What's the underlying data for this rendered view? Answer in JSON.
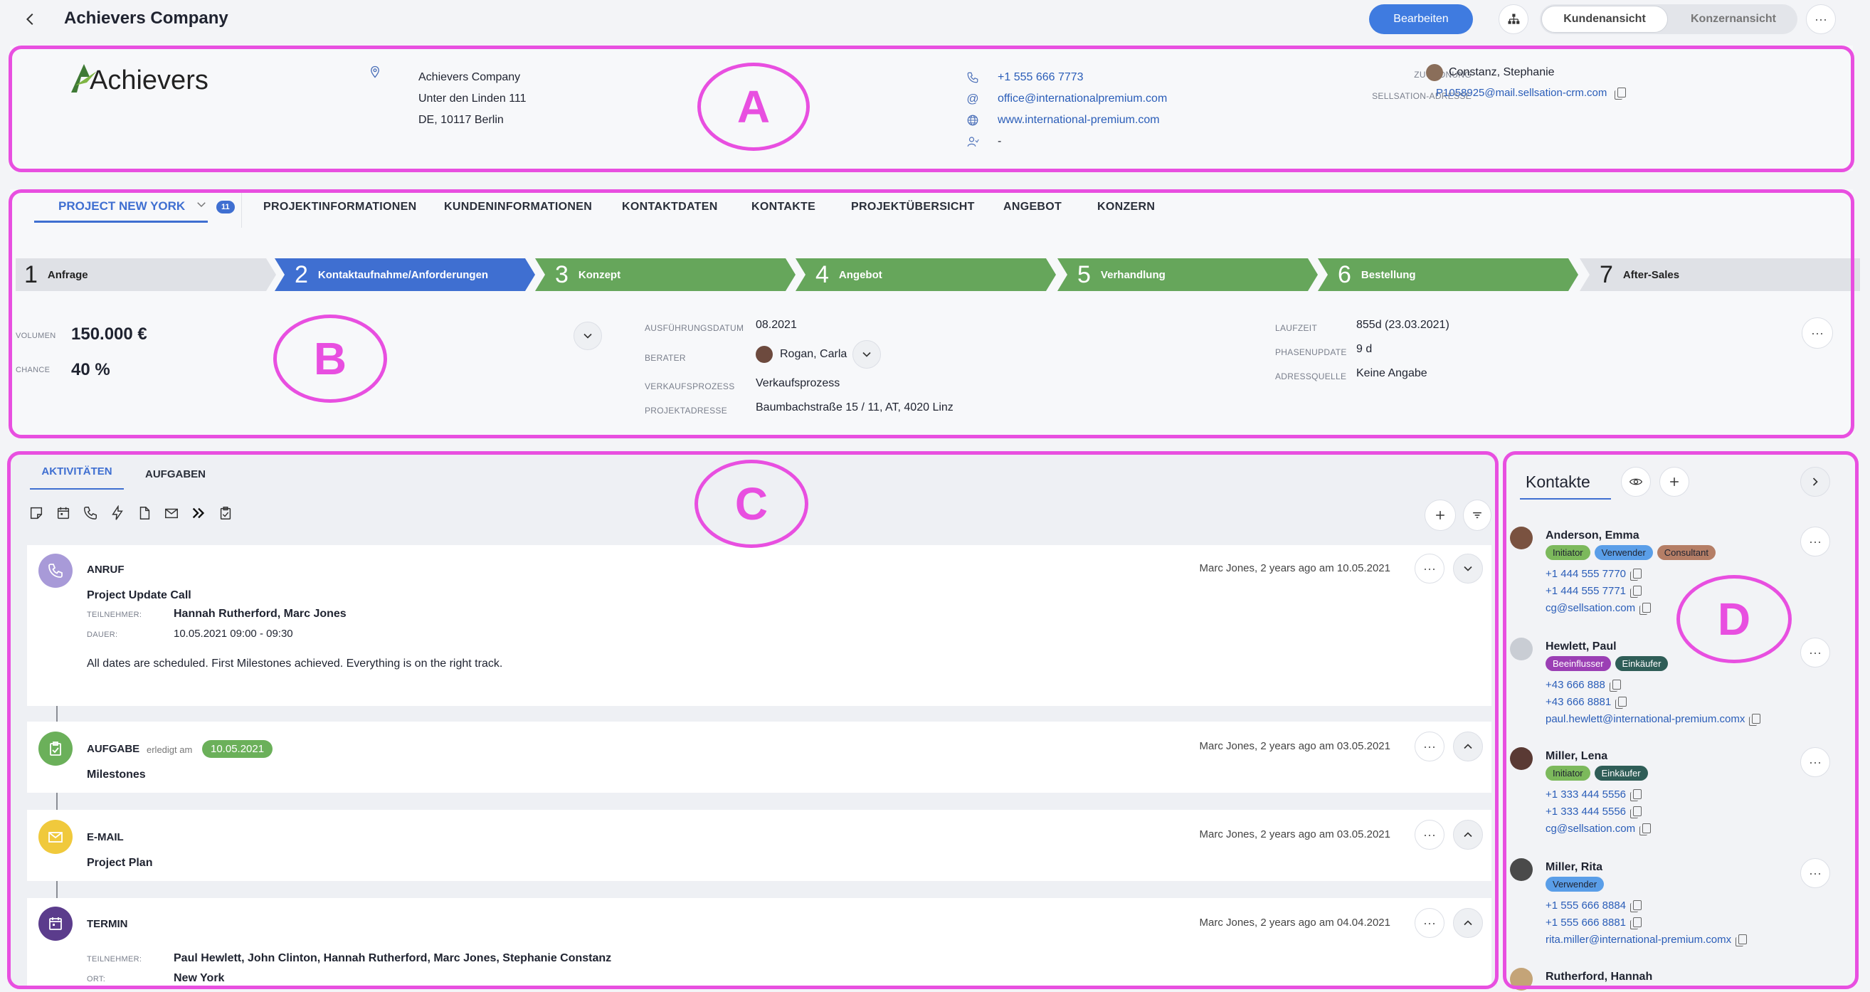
{
  "header": {
    "title": "Achievers Company",
    "edit_label": "Bearbeiten",
    "view_customer": "Kundenansicht",
    "view_group": "Konzernansicht"
  },
  "company": {
    "logo_text": "Achievers",
    "name": "Achievers Company",
    "street": "Unter den Linden 111",
    "city": "DE, 10117 Berlin",
    "phone": "+1 555 666 7773",
    "email": "office@internationalpremium.com",
    "website": "www.international-premium.com",
    "contact_person": "-",
    "assignment_label": "ZUORDNUNG",
    "assignment_value": "Constanz, Stephanie",
    "sellsation_label": "SELLSATION-ADRESSE",
    "sellsation_value": "P1058925@mail.sellsation-crm.com"
  },
  "project": {
    "name": "PROJECT NEW YORK",
    "count_badge": "11",
    "tabs": [
      "PROJEKTINFORMATIONEN",
      "KUNDENINFORMATIONEN",
      "KONTAKTDATEN",
      "KONTAKTE",
      "PROJEKTÜBERSICHT",
      "ANGEBOT",
      "KONZERN"
    ],
    "steps": [
      {
        "num": "1",
        "label": "Anfrage"
      },
      {
        "num": "2",
        "label": "Kontaktaufnahme/Anforderungen"
      },
      {
        "num": "3",
        "label": "Konzept"
      },
      {
        "num": "4",
        "label": "Angebot"
      },
      {
        "num": "5",
        "label": "Verhandlung"
      },
      {
        "num": "6",
        "label": "Bestellung"
      },
      {
        "num": "7",
        "label": "After-Sales"
      }
    ],
    "volume_label": "VOLUMEN",
    "volume_value": "150.000 €",
    "chance_label": "CHANCE",
    "chance_value": "40 %",
    "exec_date_label": "AUSFÜHRUNGSDATUM",
    "exec_date_value": "08.2021",
    "advisor_label": "BERATER",
    "advisor_value": "Rogan, Carla",
    "sales_process_label": "VERKAUFSPROZESS",
    "sales_process_value": "Verkaufsprozess",
    "project_address_label": "PROJEKTADRESSE",
    "project_address_value": "Baumbachstraße 15 / 11, AT, 4020 Linz",
    "runtime_label": "LAUFZEIT",
    "runtime_value": "855d (23.03.2021)",
    "phase_update_label": "PHASENUPDATE",
    "phase_update_value": "9 d",
    "address_source_label": "ADRESSQUELLE",
    "address_source_value": "Keine Angabe"
  },
  "activities": {
    "tab_activities": "AKTIVITÄTEN",
    "tab_tasks": "AUFGABEN",
    "items": [
      {
        "type": "ANRUF",
        "meta": "Marc Jones, 2 years ago am 10.05.2021",
        "title": "Project Update Call",
        "participants_label": "TEILNEHMER:",
        "participants": "Hannah Rutherford, Marc Jones",
        "duration_label": "DAUER:",
        "duration": "10.05.2021 09:00 - 09:30",
        "body": "All dates are scheduled. First Milestones achieved. Everything is on the right track."
      },
      {
        "type": "AUFGABE",
        "done_label": "erledigt am",
        "done_date": "10.05.2021",
        "meta": "Marc Jones, 2 years ago am 03.05.2021",
        "title": "Milestones"
      },
      {
        "type": "E-MAIL",
        "meta": "Marc Jones, 2 years ago am 03.05.2021",
        "title": "Project Plan"
      },
      {
        "type": "TERMIN",
        "meta": "Marc Jones, 2 years ago am 04.04.2021",
        "participants_label": "TEILNEHMER:",
        "participants": "Paul Hewlett, John Clinton, Hannah Rutherford, Marc Jones, Stephanie Constanz",
        "location_label": "ORT:",
        "location": "New York"
      }
    ]
  },
  "contacts": {
    "title": "Kontakte",
    "items": [
      {
        "name": "Anderson, Emma",
        "tags": [
          "Initiator",
          "Verwender",
          "Consultant"
        ],
        "phone1": "+1 444 555 7770",
        "phone2": "+1 444 555 7771",
        "email": "cg@sellsation.com"
      },
      {
        "name": "Hewlett, Paul",
        "tags": [
          "Beeinflusser",
          "Einkäufer"
        ],
        "phone1": "+43 666 888",
        "phone2": "+43 666 8881",
        "email": "paul.hewlett@international-premium.comx"
      },
      {
        "name": "Miller, Lena",
        "tags": [
          "Initiator",
          "Einkäufer"
        ],
        "phone1": "+1 333 444 5556",
        "phone2": "+1 333 444 5556",
        "email": "cg@sellsation.com"
      },
      {
        "name": "Miller, Rita",
        "tags": [
          "Verwender"
        ],
        "phone1": "+1 555 666 8884",
        "phone2": "+1 555 666 8881",
        "email": "rita.miller@international-premium.comx"
      },
      {
        "name": "Rutherford, Hannah"
      }
    ]
  },
  "annotations": [
    "A",
    "B",
    "C",
    "D"
  ],
  "colors": {
    "primary": "#3f6fd1",
    "step_green": "#66a65b",
    "step_grey": "#dfe1e6",
    "annotation": "#e84fe0"
  }
}
